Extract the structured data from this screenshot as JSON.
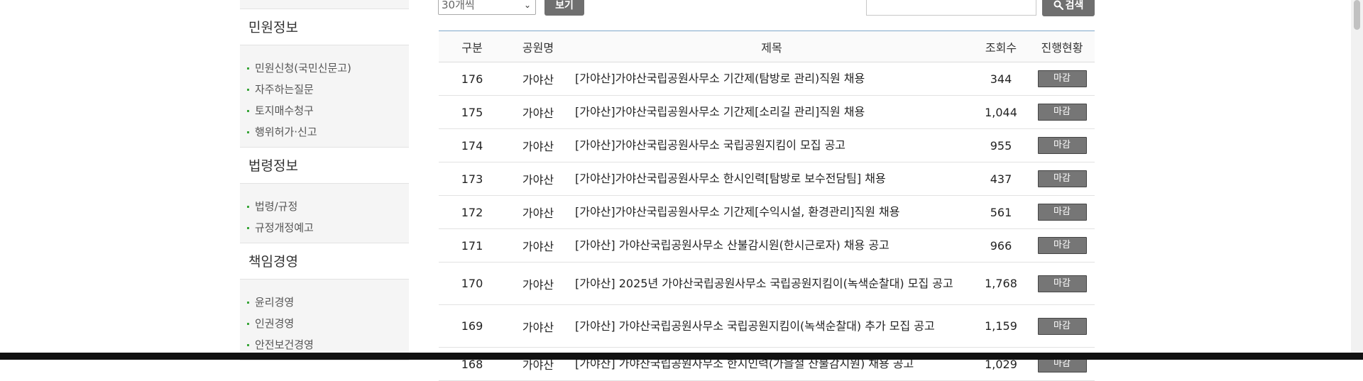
{
  "sidebar": {
    "sections": [
      {
        "title": "민원정보",
        "items": [
          "민원신청(국민신문고)",
          "자주하는질문",
          "토지매수청구",
          "행위허가·신고"
        ]
      },
      {
        "title": "법령정보",
        "items": [
          "법령/규정",
          "규정개정예고"
        ]
      },
      {
        "title": "책임경영",
        "items": [
          "윤리경영",
          "인권경영",
          "안전보건경영"
        ]
      }
    ]
  },
  "controls": {
    "per_page_value": "30개씩",
    "view_label": "보기",
    "search_placeholder": "",
    "search_label": "검색"
  },
  "table": {
    "headers": [
      "구분",
      "공원명",
      "제목",
      "조회수",
      "진행현황"
    ],
    "rows": [
      {
        "no": "176",
        "park": "가야산",
        "title": "[가야산]가야산국립공원사무소 기간제(탐방로 관리)직원 채용",
        "views": "344",
        "status": "마감"
      },
      {
        "no": "175",
        "park": "가야산",
        "title": "[가야산]가야산국립공원사무소 기간제[소리길 관리]직원 채용",
        "views": "1,044",
        "status": "마감"
      },
      {
        "no": "174",
        "park": "가야산",
        "title": "[가야산]가야산국립공원사무소 국립공원지킴이 모집 공고",
        "views": "955",
        "status": "마감"
      },
      {
        "no": "173",
        "park": "가야산",
        "title": "[가야산]가야산국립공원사무소 한시인력[탐방로 보수전담팀] 채용",
        "views": "437",
        "status": "마감"
      },
      {
        "no": "172",
        "park": "가야산",
        "title": "[가야산]가야산국립공원사무소 기간제[수익시설, 환경관리]직원 채용",
        "views": "561",
        "status": "마감"
      },
      {
        "no": "171",
        "park": "가야산",
        "title": "[가야산] 가야산국립공원사무소 산불감시원(한시근로자) 채용 공고",
        "views": "966",
        "status": "마감"
      },
      {
        "no": "170",
        "park": "가야산",
        "title": "[가야산] 2025년 가야산국립공원사무소 국립공원지킴이(녹색순찰대) 모집 공고",
        "views": "1,768",
        "status": "마감"
      },
      {
        "no": "169",
        "park": "가야산",
        "title": "[가야산] 가야산국립공원사무소 국립공원지킴이(녹색순찰대) 추가 모집 공고",
        "views": "1,159",
        "status": "마감"
      },
      {
        "no": "168",
        "park": "가야산",
        "title": "[가야산] 가야산국립공원사무소 한시인력(가을철 산불감시원) 채용 공고",
        "views": "1,029",
        "status": "마감"
      }
    ]
  }
}
